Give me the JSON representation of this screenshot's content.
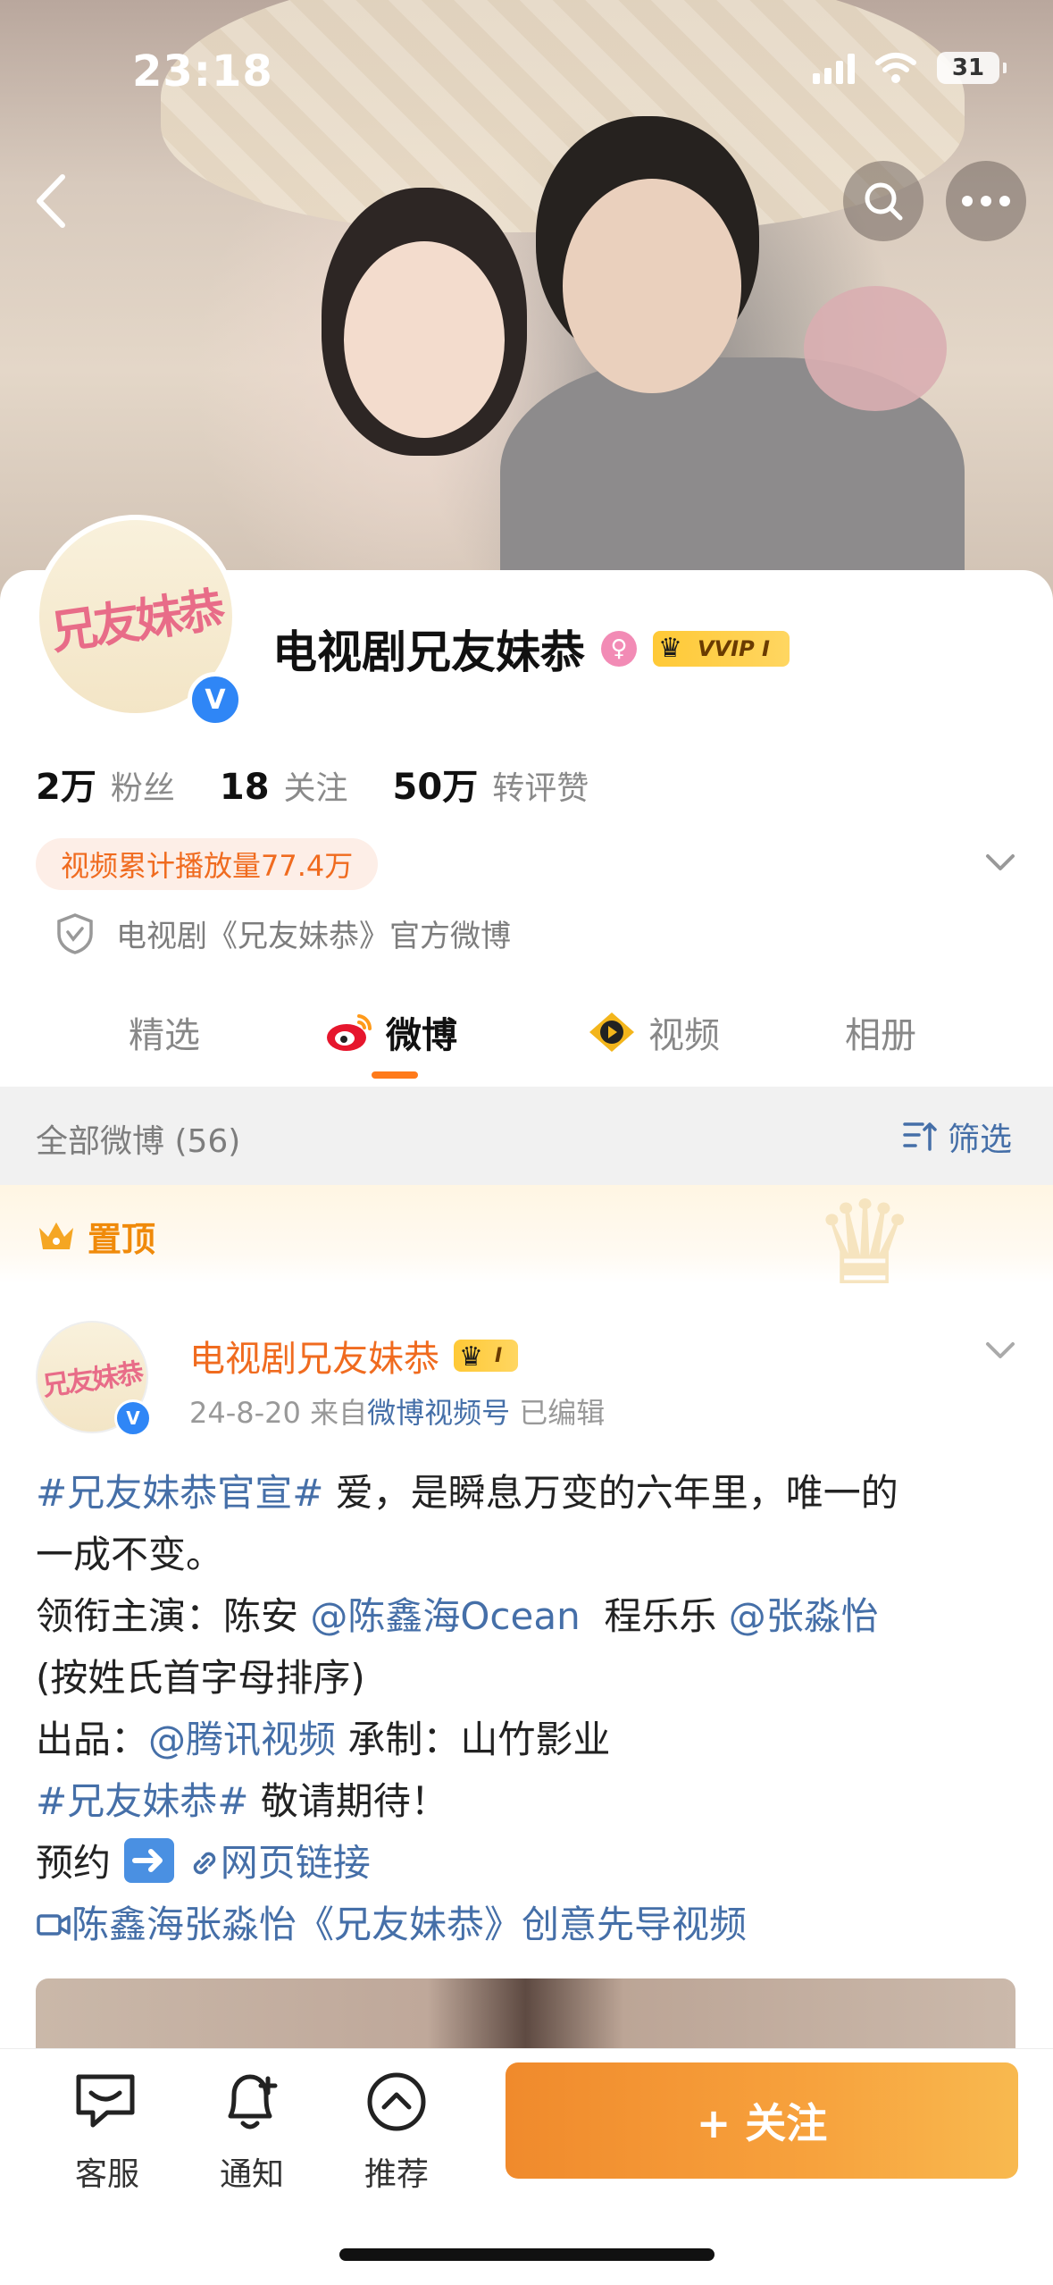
{
  "status_bar": {
    "time": "23:18",
    "battery": "31"
  },
  "profile": {
    "avatar_logo_text": "兄友妹恭",
    "verified_mark": "V",
    "name": "电视剧兄友妹恭",
    "gender_symbol": "♀",
    "vip_label": "VVIP I",
    "stats": [
      {
        "num": "2万",
        "label": "粉丝"
      },
      {
        "num": "18",
        "label": "关注"
      },
      {
        "num": "50万",
        "label": "转评赞"
      }
    ],
    "play_count": "视频累计播放量77.4万",
    "official_desc": "电视剧《兄友妹恭》官方微博"
  },
  "tabs": [
    {
      "label": "精选"
    },
    {
      "label": "微博"
    },
    {
      "label": "视频"
    },
    {
      "label": "相册"
    }
  ],
  "filter_bar": {
    "count": "全部微博 (56)",
    "filter_label": "筛选"
  },
  "pinned": {
    "label": "置顶"
  },
  "post": {
    "author": "电视剧兄友妹恭",
    "vip_label": "I",
    "date": "24-8-20",
    "source_prefix": "来自",
    "source": "微博视频号",
    "edited": "已编辑",
    "lines": {
      "l1_tag": "#兄友妹恭官宣#",
      "l1_text": " 爱，是瞬息万变的六年里，唯一的",
      "l2_text": "一成不变。",
      "l3_prefix": "领衔主演：陈安 ",
      "l3_mention1": "@陈鑫海Ocean",
      "l3_mid": "  程乐乐 ",
      "l3_mention2": "@张淼怡",
      "l4_text": "(按姓氏首字母排序)",
      "l5_prefix": "出品：",
      "l5_mention": "@腾讯视频",
      "l5_suffix": " 承制：山竹影业",
      "l6_tag": "#兄友妹恭#",
      "l6_text": " 敬请期待！",
      "l7_prefix": "预约",
      "l7_link": "网页链接",
      "l8_link": "陈鑫海张淼怡《兄友妹恭》创意先导视频"
    }
  },
  "bottom_bar": {
    "customer_service": "客服",
    "notify": "通知",
    "recommend": "推荐",
    "follow": "+ 关注"
  },
  "colors": {
    "accent_orange": "#f06b1f",
    "link_blue": "#456fa8",
    "verified_blue": "#2f86f6"
  }
}
